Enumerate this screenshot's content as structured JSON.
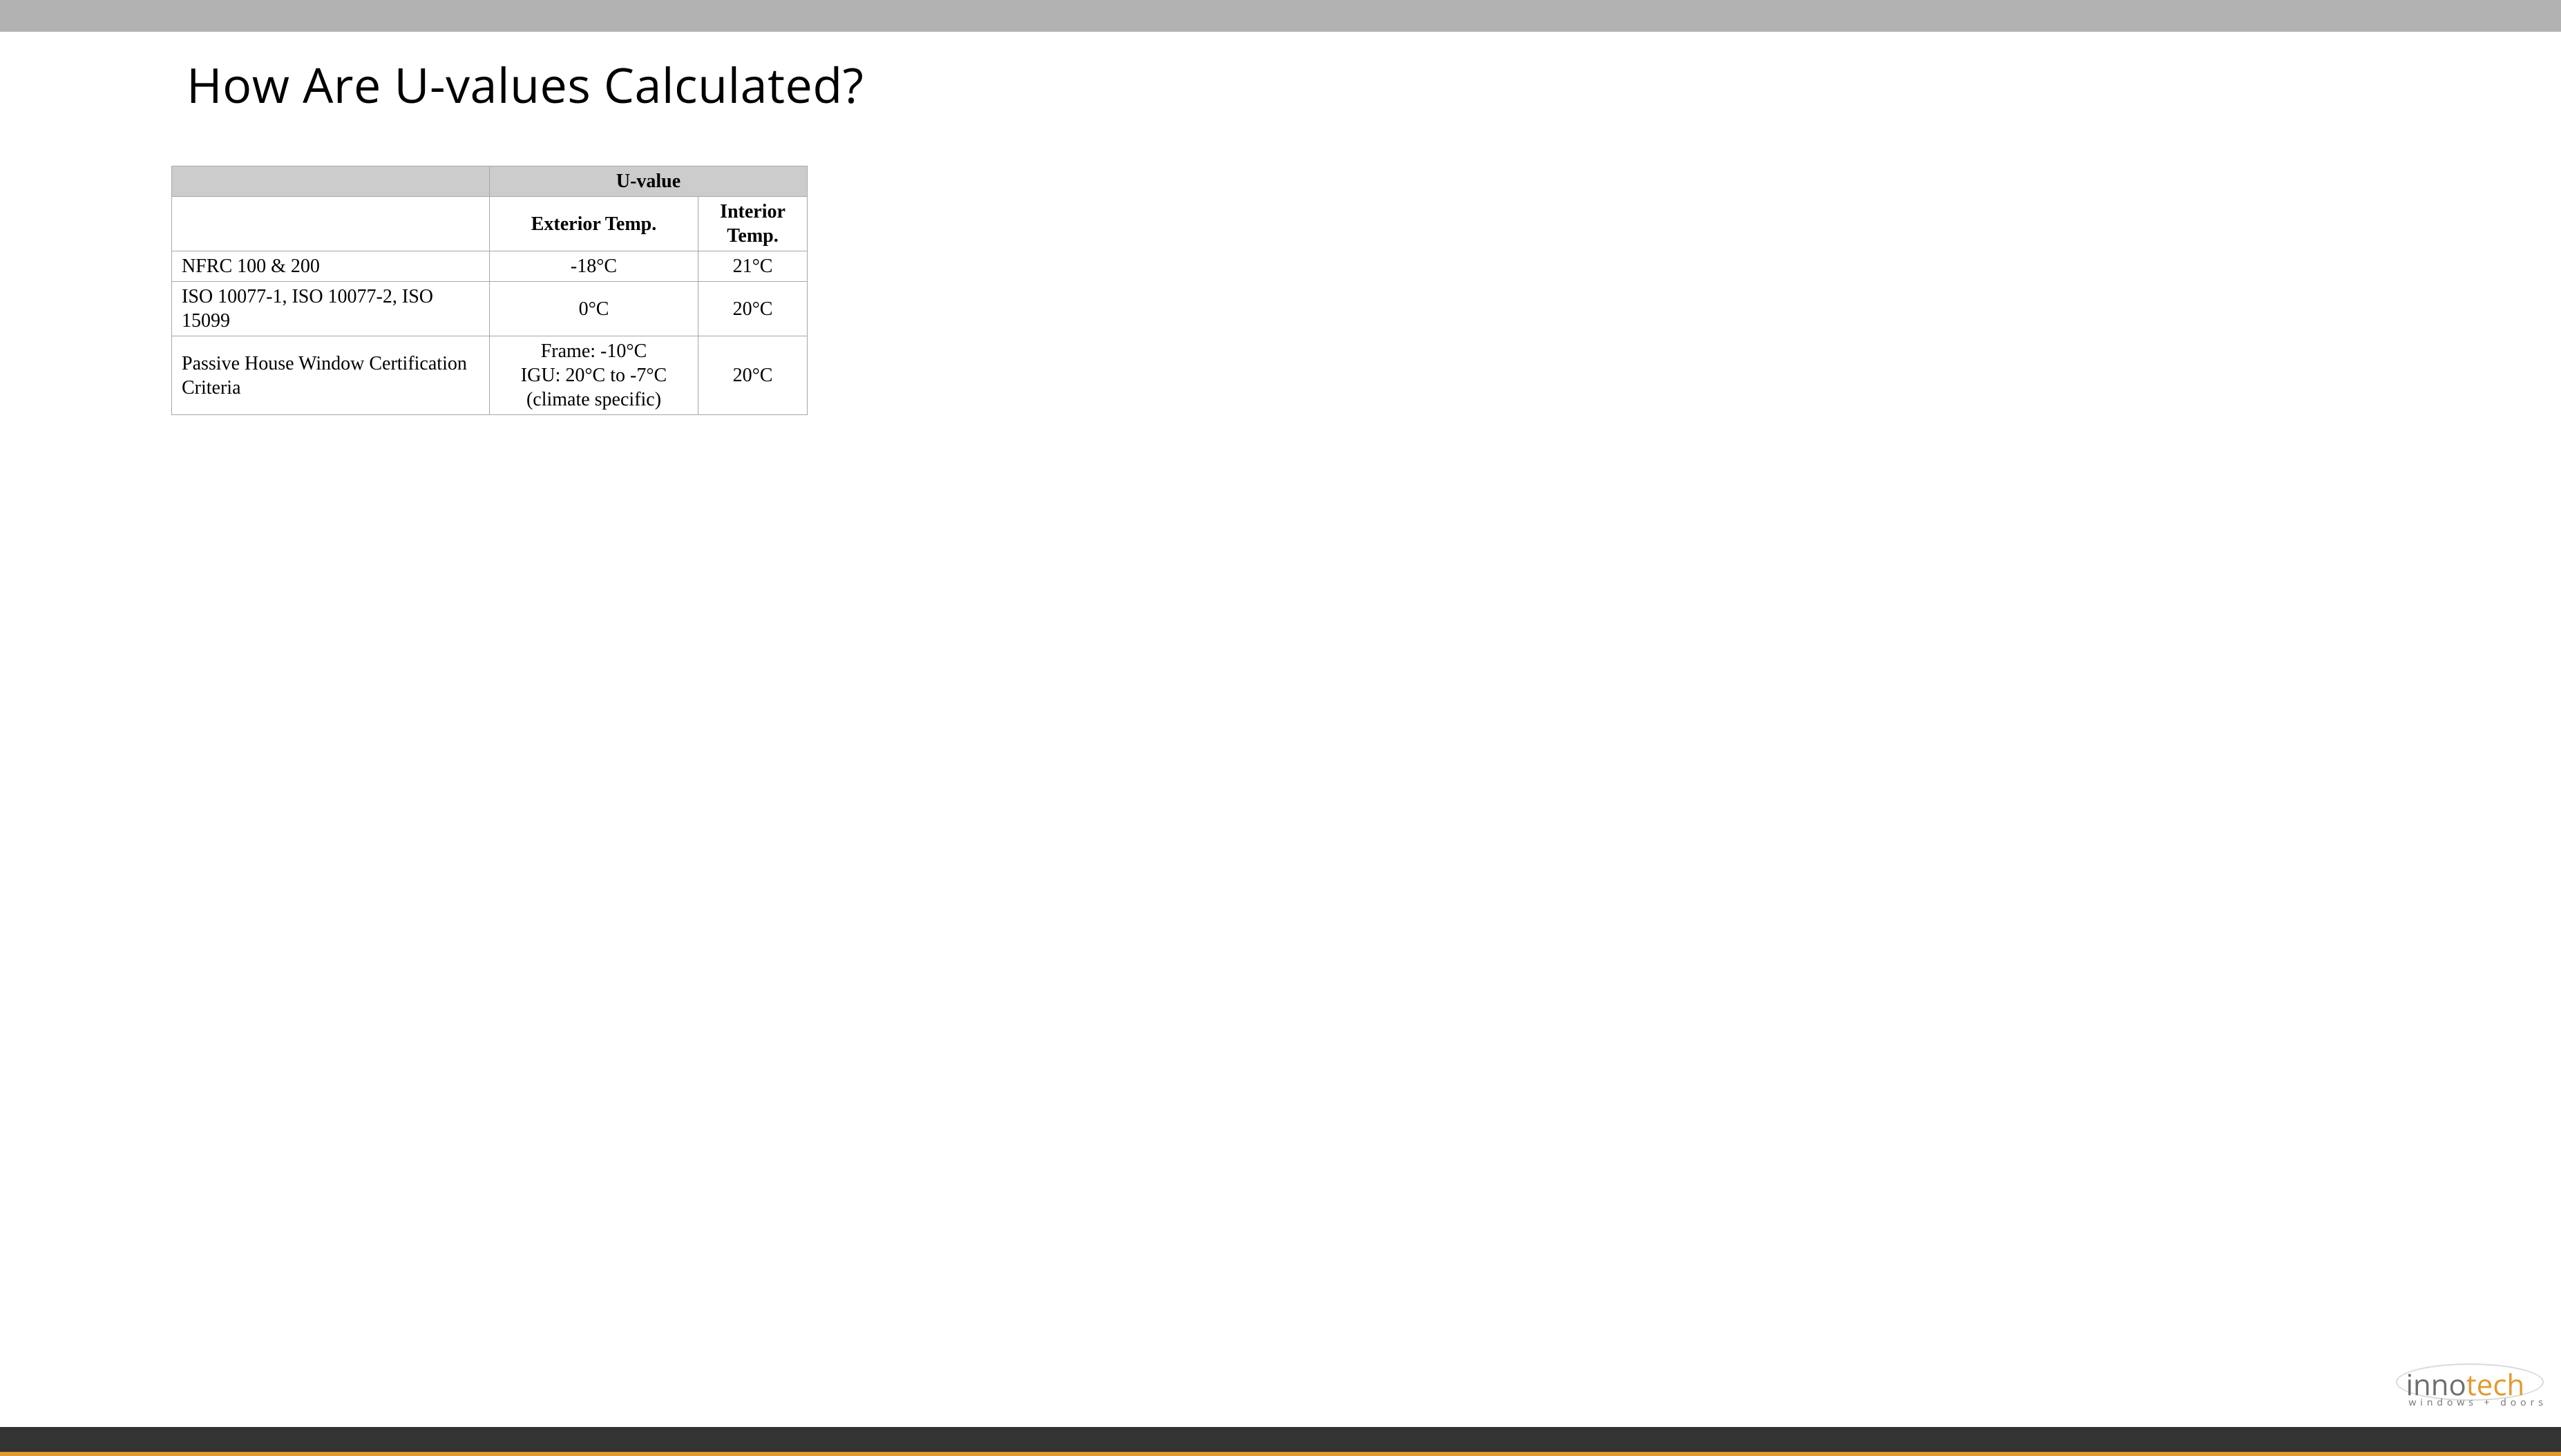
{
  "title": "How Are U-values Calculated?",
  "table": {
    "group_header": "U-value",
    "sub_headers": {
      "ext": "Exterior Temp.",
      "int": "Interior Temp."
    },
    "rows": [
      {
        "label": "NFRC 100 & 200",
        "ext": "-18°C",
        "int": "21°C"
      },
      {
        "label": "ISO 10077-1, ISO 10077-2, ISO 15099",
        "ext": "0°C",
        "int": "20°C"
      },
      {
        "label": "Passive House Window Certification Criteria",
        "ext": "Frame: -10°C\nIGU: 20°C to -7°C\n(climate specific)",
        "int": "20°C"
      }
    ]
  },
  "logo": {
    "part1": "inno",
    "part2": "tech",
    "subtitle": "windows + doors"
  }
}
